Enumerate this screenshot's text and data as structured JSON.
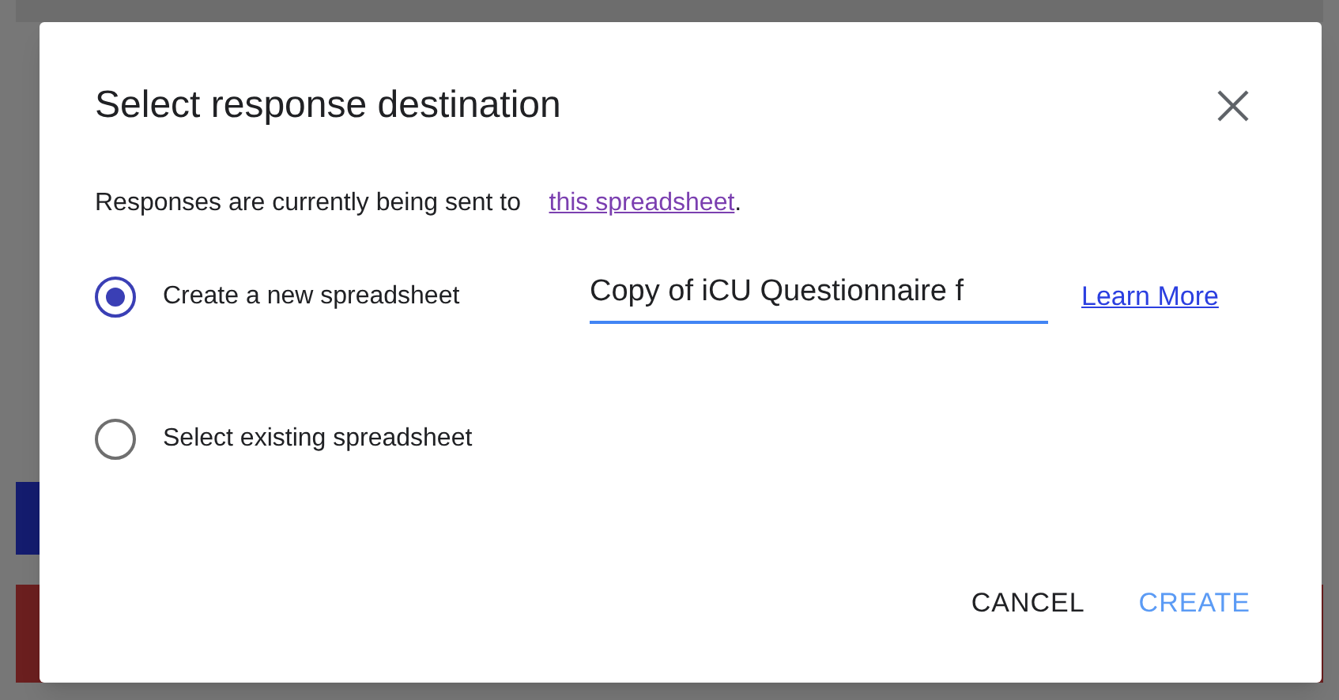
{
  "dialog": {
    "title": "Select response destination",
    "message": {
      "text": "Responses are currently being sent to",
      "link": "this spreadsheet",
      "end": "."
    },
    "options": [
      {
        "label": "Create a new spreadsheet",
        "selected": true,
        "field_value": "Copy of iCU Questionnaire f",
        "link": "Learn More"
      },
      {
        "label": "Select existing spreadsheet",
        "selected": false
      }
    ],
    "buttons": [
      {
        "label": "CANCEL",
        "kind": "secondary"
      },
      {
        "label": "CREATE",
        "kind": "primary"
      }
    ]
  }
}
